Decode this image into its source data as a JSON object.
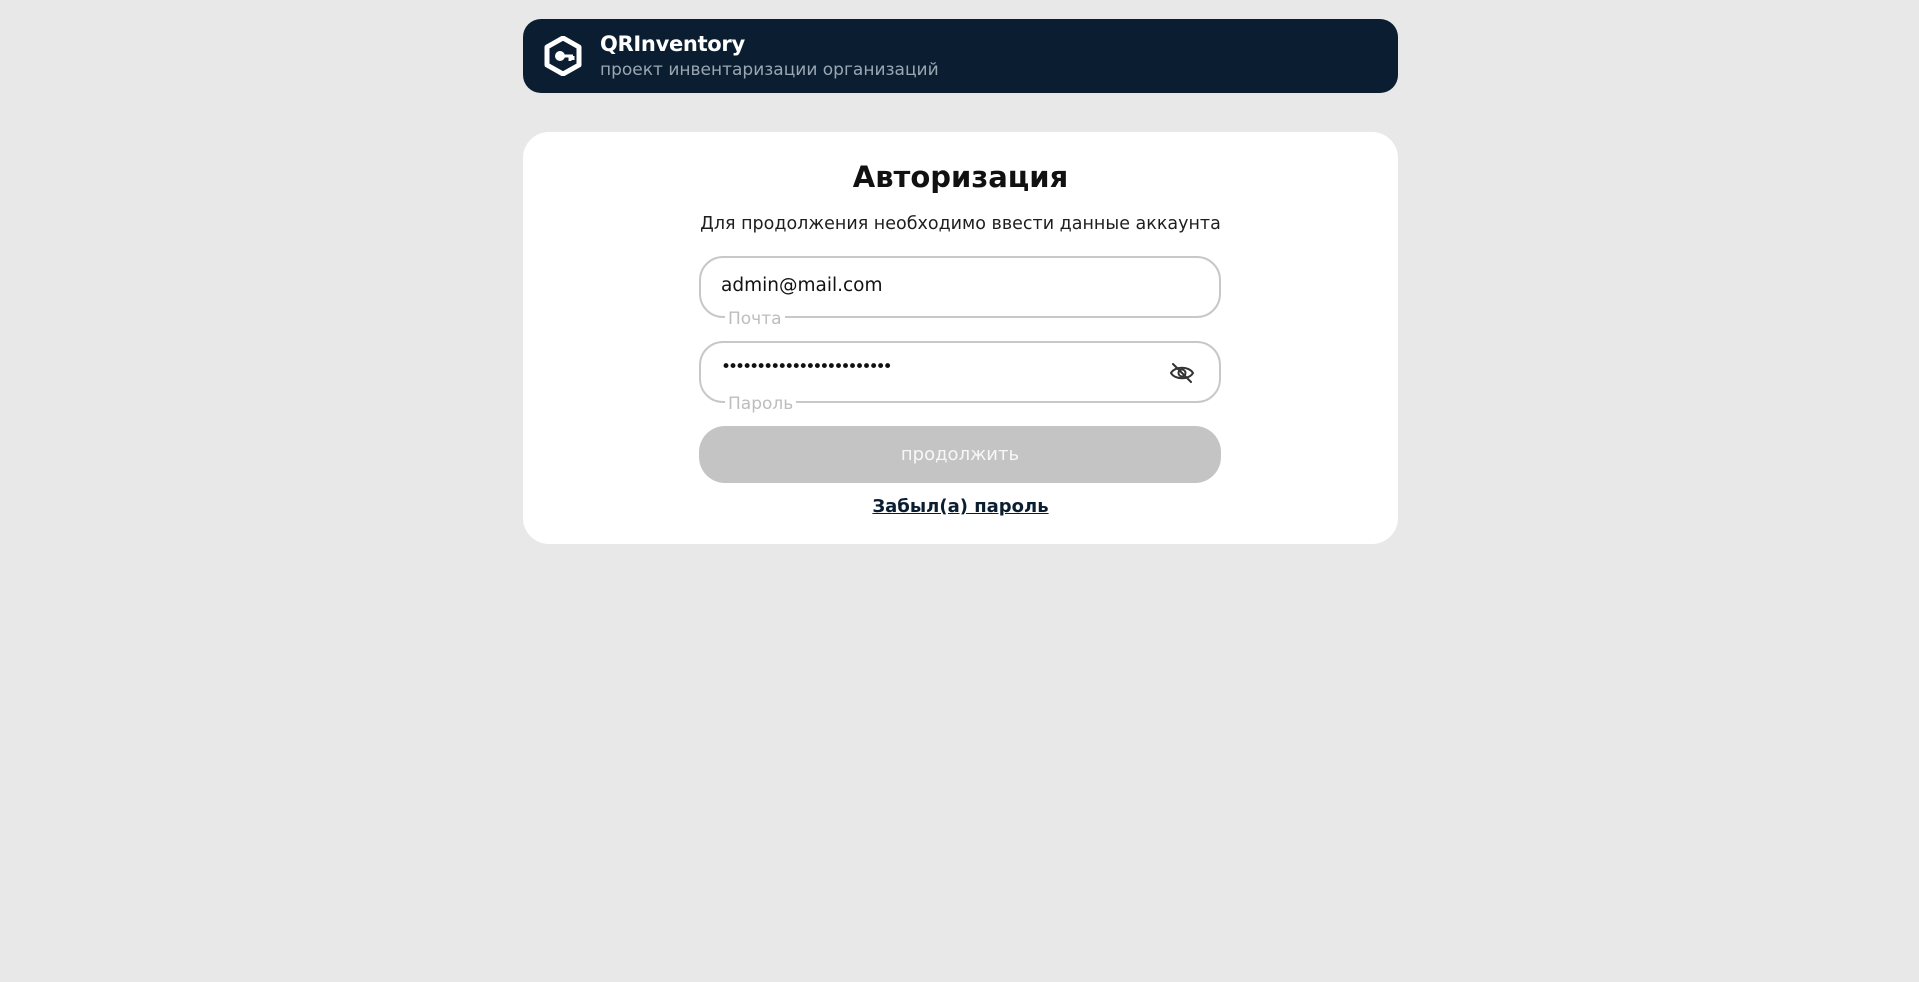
{
  "header": {
    "title": "QRInventory",
    "subtitle": "проект инвентаризации организаций",
    "logo_icon": "qr-logo-icon"
  },
  "auth": {
    "title": "Авторизация",
    "description": "Для продолжения необходимо ввести данные аккаунта",
    "email": {
      "value": "admin@mail.com",
      "label": "Почта"
    },
    "password": {
      "value": "••••••••••••••••••••••••",
      "label": "Пароль",
      "toggle_icon": "eye-off-icon"
    },
    "submit_label": "продолжить",
    "forgot_label": "Забыл(а) пароль"
  },
  "colors": {
    "header_bg": "#0b1e31",
    "page_bg": "#e8e8e8",
    "button_disabled": "#c4c4c4"
  }
}
